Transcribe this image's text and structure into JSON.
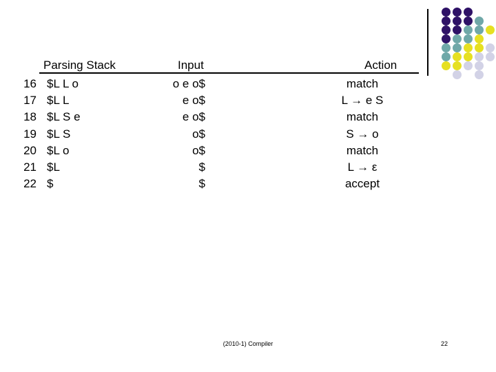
{
  "slide": {
    "page_number": "22",
    "footer_text": "(2010-1) Compiler"
  },
  "table": {
    "headers": {
      "stack": "Parsing Stack",
      "input": "Input",
      "action": "Action"
    },
    "rows": [
      {
        "num": "16",
        "stack": "$L L o",
        "input": "o e o$",
        "action": "match"
      },
      {
        "num": "17",
        "stack": "$L L",
        "input": "e o$",
        "action": "L → e S"
      },
      {
        "num": "18",
        "stack": "$L S e",
        "input": "e o$",
        "action": "match"
      },
      {
        "num": "19",
        "stack": "$L S",
        "input": "o$",
        "action": "S → o"
      },
      {
        "num": "20",
        "stack": "$L o",
        "input": "o$",
        "action": "match"
      },
      {
        "num": "21",
        "stack": "$L",
        "input": "$",
        "action": "L → ε"
      },
      {
        "num": "22",
        "stack": "$",
        "input": "$",
        "action": "accept"
      }
    ]
  },
  "decor": {
    "colors": {
      "purple": "#2e1166",
      "teal": "#6fa8a8",
      "yellow": "#e6e021",
      "lavender": "#d2d2e6"
    },
    "dot_size": 13,
    "step_x": 16,
    "step_y": 13,
    "grid": [
      [
        "purple",
        "purple",
        "purple",
        "",
        ""
      ],
      [
        "purple",
        "purple",
        "purple",
        "teal",
        ""
      ],
      [
        "purple",
        "purple",
        "teal",
        "teal",
        "yellow"
      ],
      [
        "purple",
        "teal",
        "teal",
        "yellow",
        ""
      ],
      [
        "teal",
        "teal",
        "yellow",
        "yellow",
        "lavender"
      ],
      [
        "teal",
        "yellow",
        "yellow",
        "lavender",
        "lavender"
      ],
      [
        "yellow",
        "yellow",
        "lavender",
        "lavender",
        ""
      ],
      [
        "",
        "lavender",
        "",
        "lavender",
        ""
      ]
    ]
  }
}
